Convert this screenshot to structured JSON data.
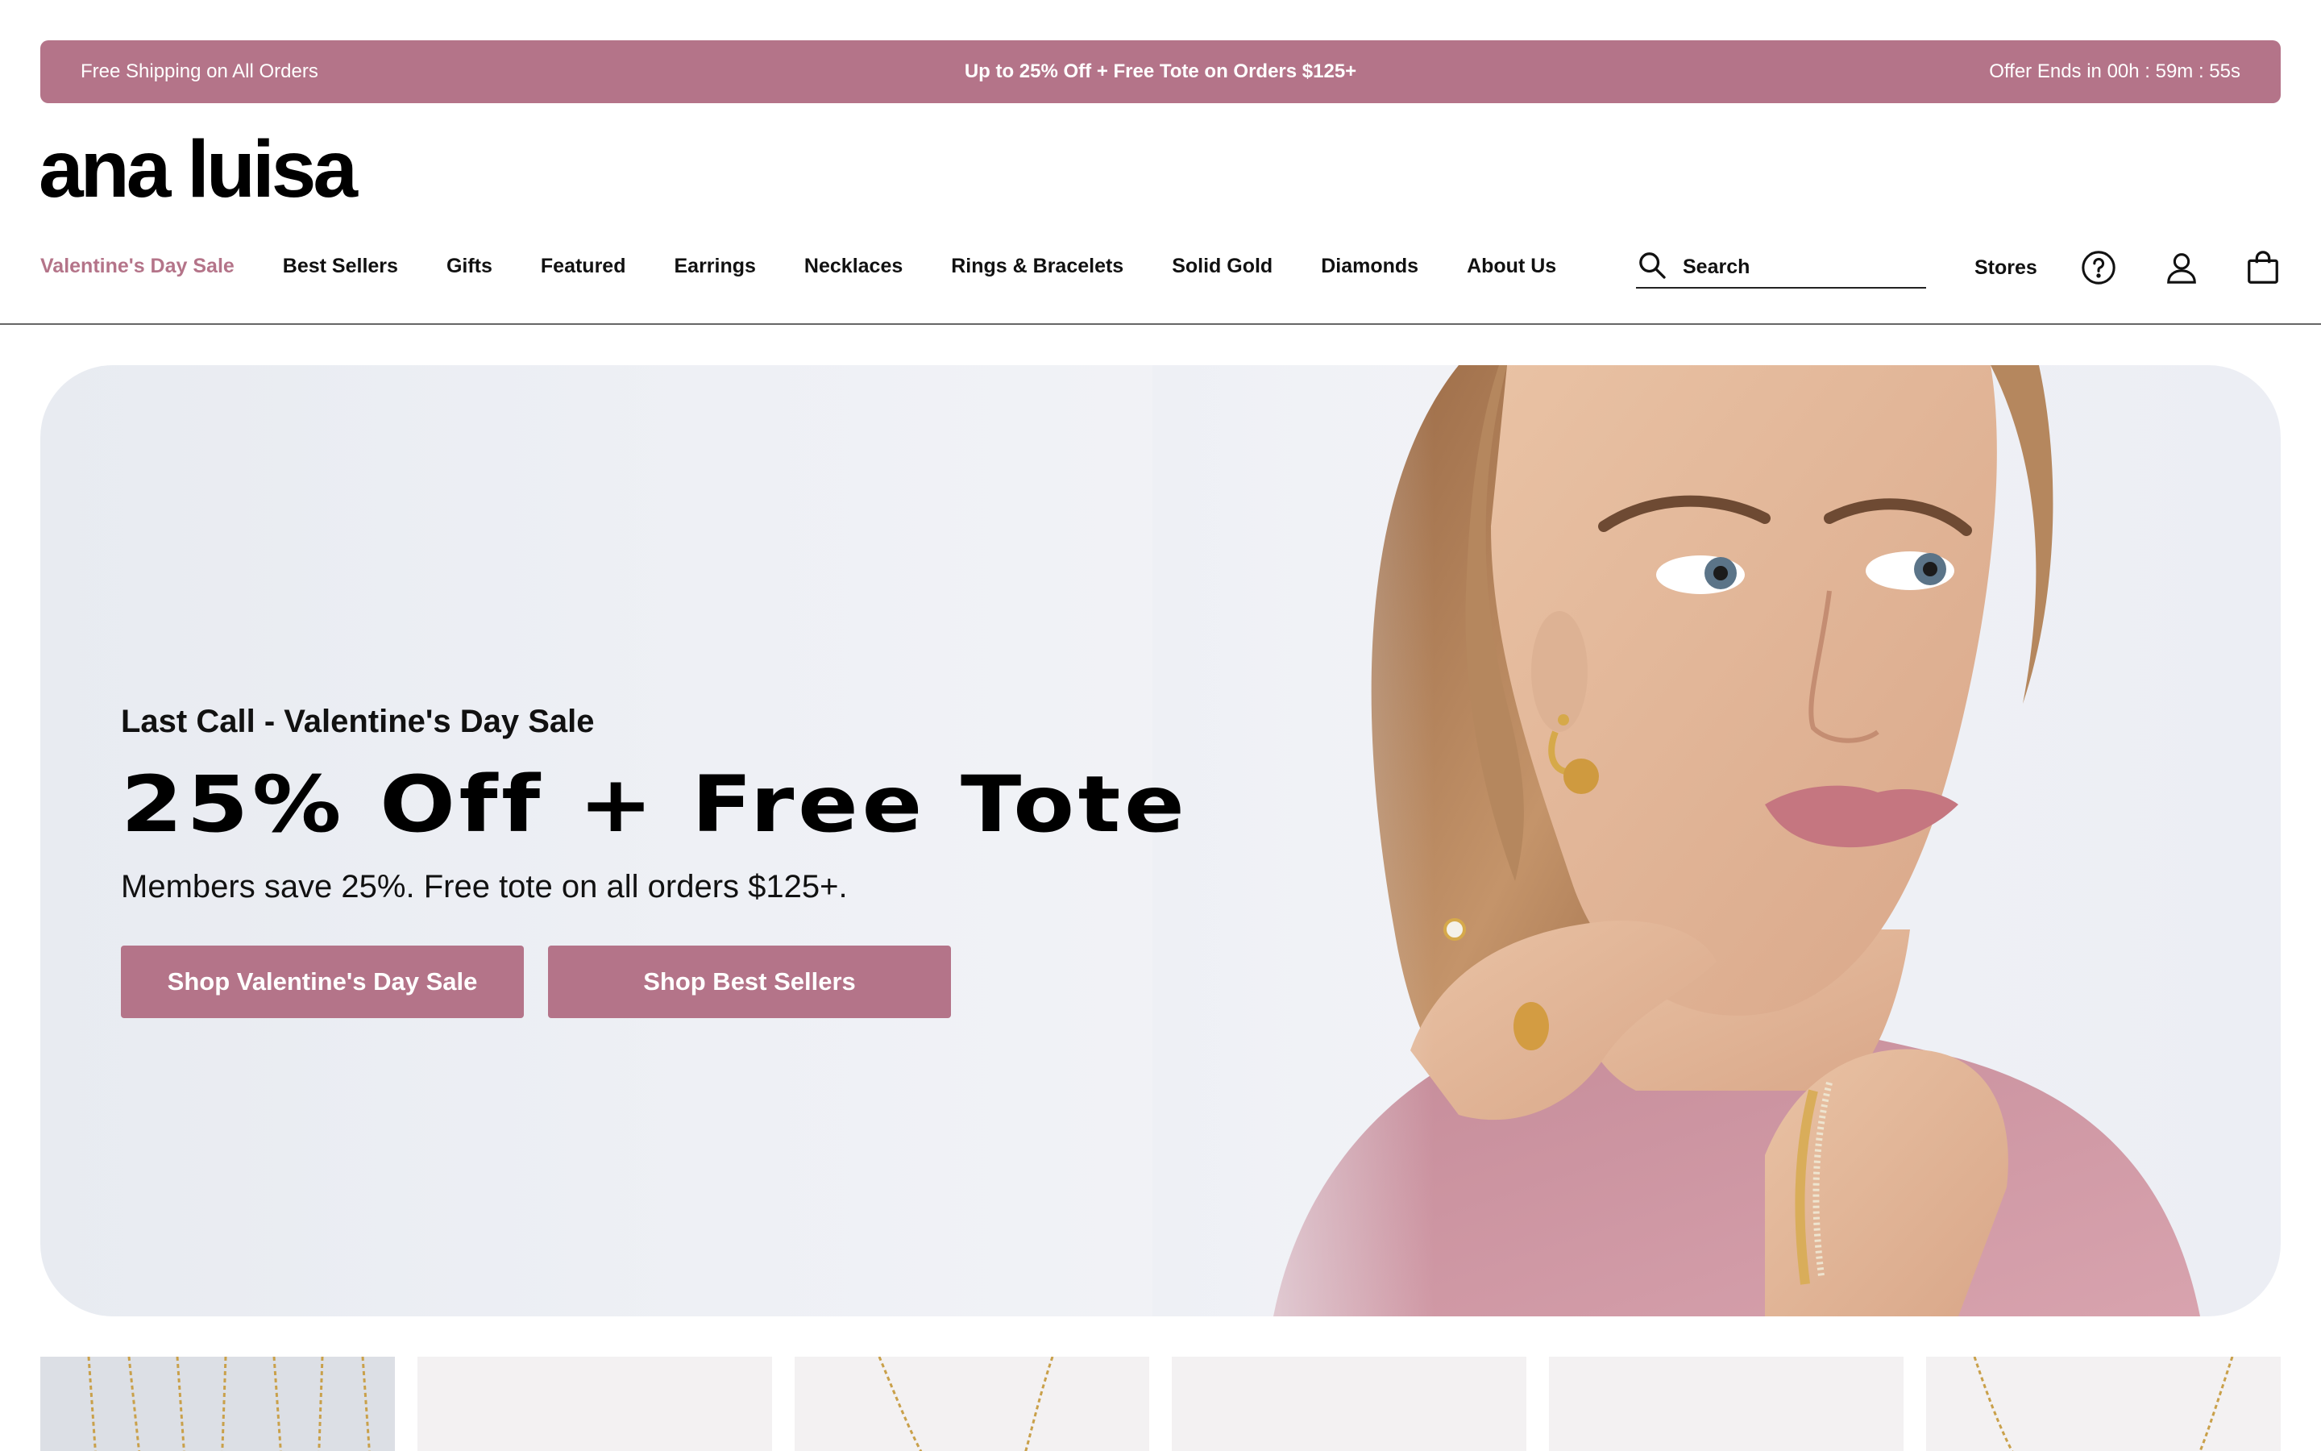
{
  "promo": {
    "left": "Free Shipping on All Orders",
    "center": "Up to 25% Off + Free Tote on Orders $125+",
    "right": "Offer Ends in 00h : 59m : 55s"
  },
  "brand": {
    "logo": "ana luisa"
  },
  "nav": {
    "items": [
      {
        "label": "Valentine's Day Sale"
      },
      {
        "label": "Best Sellers"
      },
      {
        "label": "Gifts"
      },
      {
        "label": "Featured"
      },
      {
        "label": "Earrings"
      },
      {
        "label": "Necklaces"
      },
      {
        "label": "Rings & Bracelets"
      },
      {
        "label": "Solid Gold"
      },
      {
        "label": "Diamonds"
      },
      {
        "label": "About Us"
      }
    ]
  },
  "header": {
    "search_placeholder": "Search",
    "stores_label": "Stores",
    "icons": [
      "search-icon",
      "help-icon",
      "account-icon",
      "bag-icon"
    ]
  },
  "hero": {
    "eyebrow": "Last Call - Valentine's Day Sale",
    "title": "25% Off + Free Tote",
    "subtitle": "Members save 25%. Free tote on all orders $125+.",
    "primary_button": "Shop Valentine's Day Sale",
    "secondary_button": "Shop Best Sellers"
  },
  "colors": {
    "accent": "#b47489",
    "text": "#111111",
    "hero_bg": "#eef0f5"
  }
}
